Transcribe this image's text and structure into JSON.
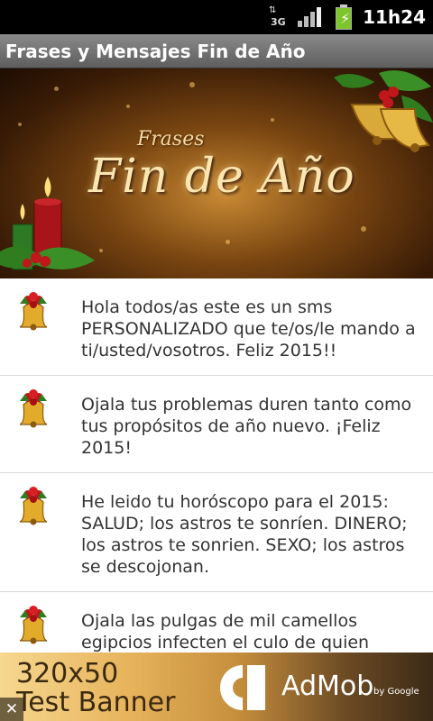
{
  "status_bar": {
    "network": "3G",
    "time": "11h24",
    "icons": [
      "data-arrows-icon",
      "signal-icon",
      "battery-charging-icon"
    ]
  },
  "app": {
    "title": "Frases y Mensajes Fin de Año"
  },
  "banner": {
    "subtitle": "Frases",
    "title": "Fin de Año"
  },
  "messages": [
    "Hola todos/as este es un sms PERSONALIZADO que te/os/le mando a ti/usted/vosotros. Feliz 2015!!",
    "Ojala tus problemas duren tanto como tus propósitos de año nuevo. ¡Feliz 2015!",
    "He leido tu horóscopo para el 2015: SALUD; los astros te sonríen. DINERO; los astros te sonrien. SEXO; los astros se descojonan.",
    "Ojala las pulgas de mil camellos egipcios infecten el culo de quien"
  ],
  "ad": {
    "line1": "320x50",
    "line2": "Test Banner",
    "brand": "AdMob",
    "byline": "by Google",
    "close": "✕"
  },
  "colors": {
    "status_bar": "#000000",
    "title_bar": "#707070",
    "text": "#333333",
    "battery": "#7cc52a"
  }
}
